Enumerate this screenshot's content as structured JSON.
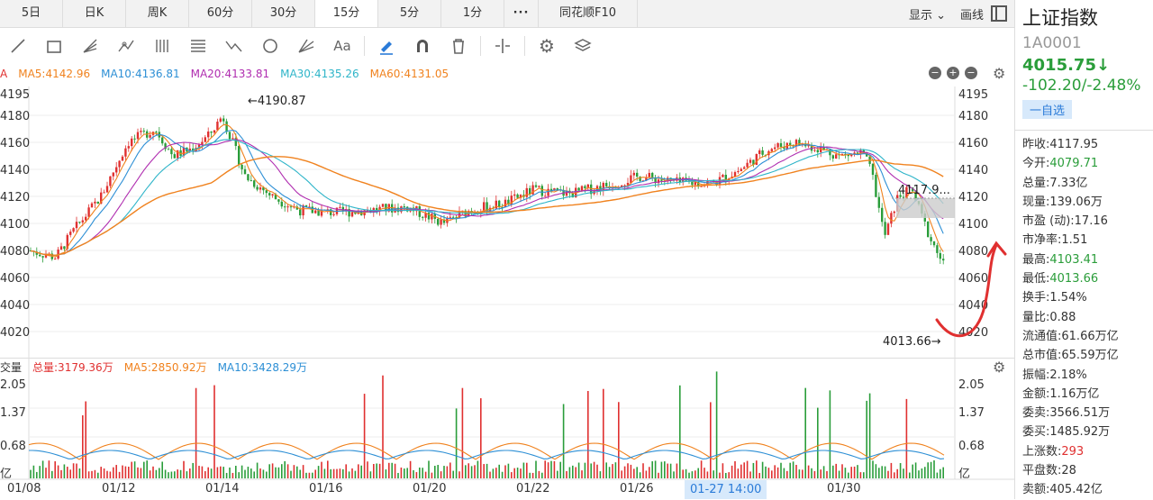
{
  "tabs": [
    "5日",
    "日K",
    "周K",
    "60分",
    "30分",
    "15分",
    "5分",
    "1分",
    "···",
    "同花顺F10"
  ],
  "active_tab": "15分",
  "tabs_right": {
    "display": "显示 ⌄",
    "draw": "画线"
  },
  "ma_legend": [
    {
      "label": "MA5:4142.96",
      "color": "#f0821e"
    },
    {
      "label": "MA10:4136.81",
      "color": "#2d8fd5"
    },
    {
      "label": "MA20:4133.81",
      "color": "#b02eb0"
    },
    {
      "label": "MA30:4135.26",
      "color": "#2fb5c9"
    },
    {
      "label": "MA60:4131.05",
      "color": "#f0821e"
    }
  ],
  "ma_prefix": "A",
  "vol_legend": [
    {
      "label": "总量:3179.36万",
      "color": "#e03030"
    },
    {
      "label": "MA5:2850.92万",
      "color": "#f0821e"
    },
    {
      "label": "MA10:3428.29万",
      "color": "#2d8fd5"
    }
  ],
  "vol_prefix": "交量",
  "price_axis": [
    "4195",
    "4180",
    "4160",
    "4140",
    "4120",
    "4100",
    "4080",
    "4060",
    "4040",
    "4020"
  ],
  "vol_axis": [
    "2.05",
    "1.37",
    "0.68",
    "亿"
  ],
  "dates": [
    "01/08",
    "01/12",
    "01/14",
    "01/16",
    "01/20",
    "01/22",
    "01/26",
    "01/30"
  ],
  "crosshair_date": "01-27 14:00",
  "annotations": {
    "high": "←4190.87",
    "low": "4013.66→",
    "cross_price": "4117.9..."
  },
  "side": {
    "name": "上证指数",
    "code": "1A0001",
    "price": "4015.75↓",
    "change": "-102.20/-2.48%",
    "watch": "一自选",
    "stats": [
      {
        "k": "昨收:",
        "v": "4117.95",
        "c": ""
      },
      {
        "k": "今开:",
        "v": "4079.71",
        "c": "green"
      },
      {
        "k": "总量:",
        "v": "7.33亿",
        "c": ""
      },
      {
        "k": "现量:",
        "v": "139.06万",
        "c": ""
      },
      {
        "k": "市盈 (动):",
        "v": "17.16",
        "c": ""
      },
      {
        "k": "市净率:",
        "v": "1.51",
        "c": ""
      },
      {
        "k": "最高:",
        "v": "4103.41",
        "c": "green"
      },
      {
        "k": "最低:",
        "v": "4013.66",
        "c": "green"
      },
      {
        "k": "换手:",
        "v": "1.54%",
        "c": ""
      },
      {
        "k": "量比:",
        "v": "0.88",
        "c": ""
      },
      {
        "k": "流通值:",
        "v": "61.66万亿",
        "c": ""
      },
      {
        "k": "总市值:",
        "v": "65.59万亿",
        "c": ""
      },
      {
        "k": "振幅:",
        "v": "2.18%",
        "c": ""
      },
      {
        "k": "金额:",
        "v": "1.16万亿",
        "c": ""
      },
      {
        "k": "委卖:",
        "v": "3566.51万",
        "c": ""
      },
      {
        "k": "委买:",
        "v": "1485.92万",
        "c": ""
      },
      {
        "k": "上涨数:",
        "v": "293",
        "c": "red"
      },
      {
        "k": "平盘数:",
        "v": "28",
        "c": ""
      },
      {
        "k": "卖额:",
        "v": "405.42亿",
        "c": ""
      }
    ]
  },
  "colors": {
    "up": "#e03030",
    "down": "#2a9d3a",
    "annot": "#e03030"
  }
}
